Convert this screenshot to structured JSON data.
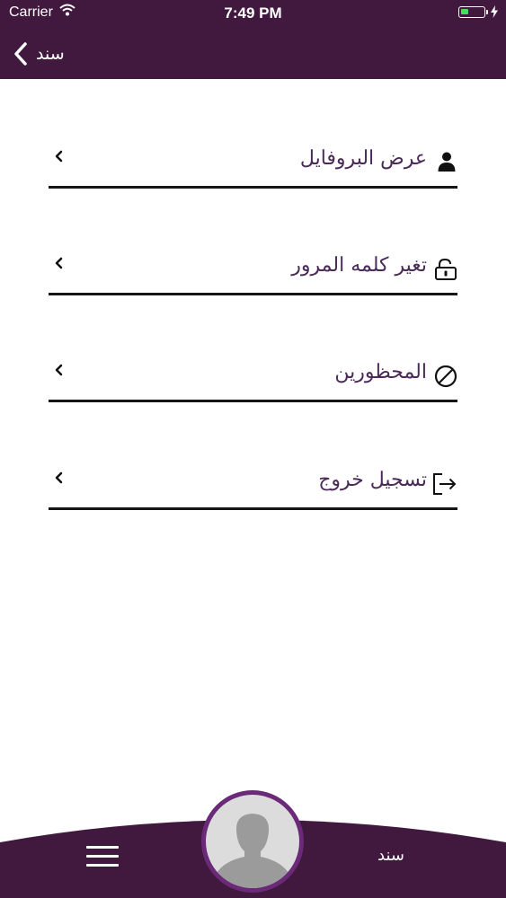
{
  "status_bar": {
    "carrier": "Carrier",
    "time": "7:49 PM",
    "battery_level": 0.35
  },
  "nav": {
    "back_label": "سند"
  },
  "menu": {
    "items": [
      {
        "label": "عرض البروفايل",
        "icon": "person-icon"
      },
      {
        "label": "تغير كلمه المرور",
        "icon": "lock-icon"
      },
      {
        "label": "المحظورين",
        "icon": "blocked-icon"
      },
      {
        "label": "تسجيل خروج",
        "icon": "logout-icon"
      }
    ]
  },
  "bottom_bar": {
    "title": "سند"
  },
  "colors": {
    "brand": "#41193e",
    "accent": "#6b2a77",
    "label": "#4a2b58"
  }
}
